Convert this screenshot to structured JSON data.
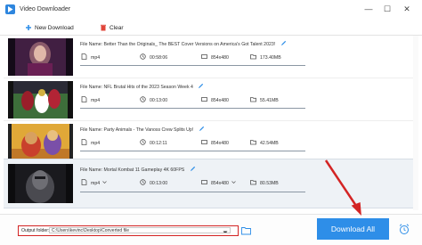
{
  "app": {
    "title": "Video Downloader"
  },
  "window_controls": {
    "minimize": "—",
    "maximize": "☐",
    "close": "✕"
  },
  "toolbar": {
    "new_download": "New Download",
    "clear": "Clear"
  },
  "items": [
    {
      "file_name": "File Name: Better Than the Originals_ The BEST Cover Versions on America's Got Talent 2023!",
      "format": "mp4",
      "duration": "00:58:06",
      "resolution": "854x480",
      "size": "173.40MB"
    },
    {
      "file_name": "File Name: NFL Brutal Hits of the 2023 Season Week 4",
      "format": "mp4",
      "duration": "00:13:00",
      "resolution": "854x480",
      "size": "55.41MB"
    },
    {
      "file_name": "File Name: Party Animals - The Vanoss Crew Splits Up!",
      "format": "mp4",
      "duration": "00:12:11",
      "resolution": "854x480",
      "size": "42.54MB"
    },
    {
      "file_name": "File Name: Mortal Kombat 11 Gameplay 4K 60FPS",
      "format": "mp4",
      "duration": "00:13:00",
      "resolution": "854x480",
      "size": "80.53MB"
    }
  ],
  "output": {
    "label": "Output folder:",
    "path": "C:\\Users\\kevinc\\Desktop\\Converted file"
  },
  "download_all": "Download All",
  "colors": {
    "accent": "#2e8ee8",
    "highlight": "#d32424"
  }
}
